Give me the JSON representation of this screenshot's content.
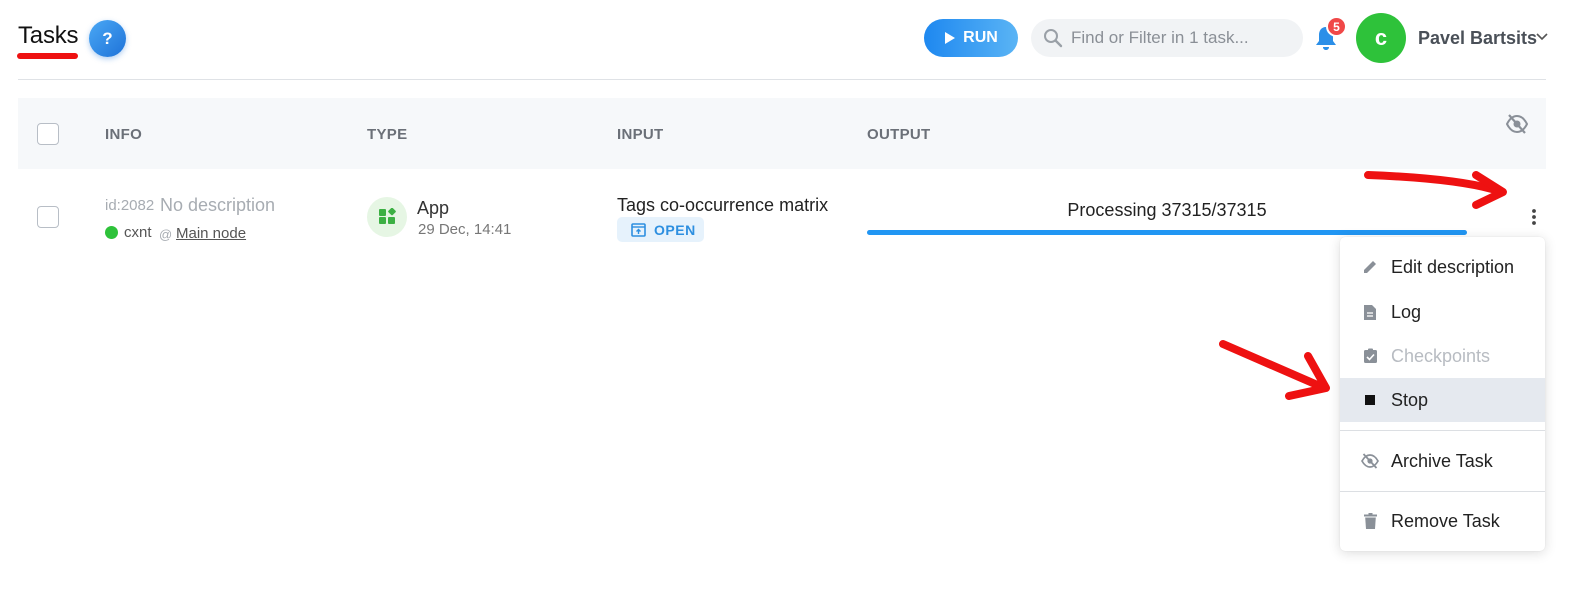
{
  "header": {
    "title": "Tasks",
    "help_label": "?",
    "run_label": "RUN",
    "search_placeholder": "Find or Filter in 1 task...",
    "notification_count": "5",
    "avatar_letter": "c",
    "user_name": "Pavel Bartsits"
  },
  "table": {
    "columns": [
      "INFO",
      "TYPE",
      "INPUT",
      "OUTPUT"
    ],
    "rows": [
      {
        "id": "id:2082",
        "description": "No description",
        "workspace": "cxnt",
        "at": "@",
        "node": "Main node",
        "type": "App",
        "date": "29 Dec, 14:41",
        "input": "Tags co-occurrence matrix",
        "open_label": "OPEN",
        "output_status": "Processing 37315/37315",
        "progress": 1.0
      }
    ]
  },
  "menu": {
    "items": [
      {
        "label": "Edit description",
        "icon": "pencil-icon",
        "enabled": true
      },
      {
        "label": "Log",
        "icon": "document-icon",
        "enabled": true
      },
      {
        "label": "Checkpoints",
        "icon": "clipboard-check-icon",
        "enabled": false
      },
      {
        "label": "Stop",
        "icon": "stop-icon",
        "enabled": true,
        "highlighted": true
      },
      {
        "label": "Archive Task",
        "icon": "eye-off-icon",
        "enabled": true
      },
      {
        "label": "Remove Task",
        "icon": "trash-icon",
        "enabled": true
      }
    ]
  },
  "colors": {
    "accent": "#2196f3",
    "status_online": "#2ec23a",
    "badge": "#f04848",
    "annotation": "#ee1111"
  }
}
